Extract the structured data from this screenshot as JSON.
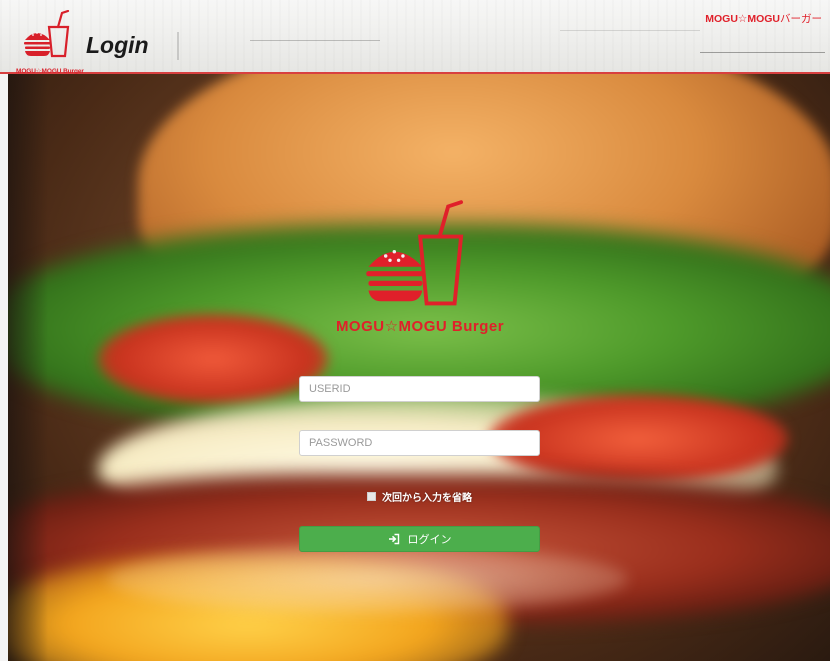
{
  "header": {
    "page_title": "Login",
    "logo_caption": "MOGU☆MOGU Burger",
    "brand_link_bold": "MOGU☆MOGU",
    "brand_link_rest": "バーガー"
  },
  "center_logo": {
    "caption": "MOGU☆MOGU Burger"
  },
  "form": {
    "userid_placeholder": "USERID",
    "userid_value": "",
    "password_placeholder": "PASSWORD",
    "password_value": "",
    "remember_label": "次回から入力を省略",
    "remember_checked": false,
    "login_label": "ログイン"
  },
  "icons": {
    "logo": "burger-and-drink-icon",
    "login": "sign-in-icon"
  },
  "colors": {
    "brand_red": "#e0202a",
    "login_green": "#4cae4c",
    "header_rule": "#d84040"
  }
}
